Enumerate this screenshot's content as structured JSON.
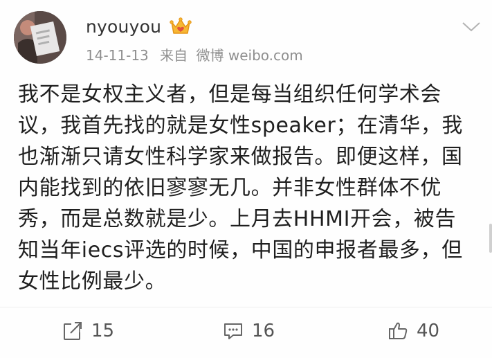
{
  "post": {
    "username": "nyouyou",
    "date": "14-11-13",
    "source_prefix": "来自",
    "source": "微博 weibo.com",
    "text": "我不是女权主义者，但是每当组织任何学术会\n议，我首先找的就是女性speaker；在清华，我\n也渐渐只请女性科学家来做报告。即便这样，国\n内能找到的依旧寥寥无几。并非女性群体不优\n秀，而是总数就是少。上月去HHMI开会，被告\n知当年iecs评选的时候，中国的申报者最多，但\n女性比例最少。"
  },
  "actions": {
    "repost_count": "15",
    "comment_count": "16",
    "like_count": "40"
  },
  "icons": {
    "vip": "vip-crown-icon",
    "menu": "chevron-down-icon",
    "repost": "repost-icon",
    "comment": "comment-icon",
    "like": "thumbs-up-icon"
  },
  "colors": {
    "accent_vip": "#f5a623",
    "text": "#1f1f1f",
    "meta": "#8e8e8e"
  }
}
